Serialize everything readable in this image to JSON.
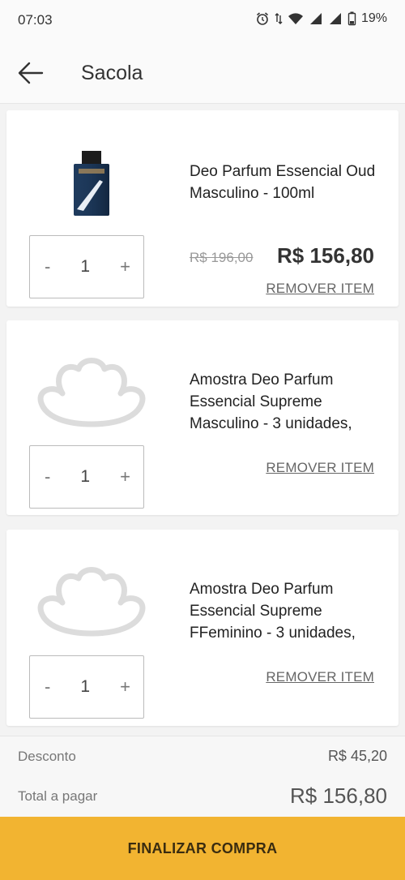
{
  "status_bar": {
    "time": "07:03",
    "battery": "19%"
  },
  "header": {
    "title": "Sacola"
  },
  "items": [
    {
      "name": "Deo Parfum Essencial Oud Masculino - 100ml",
      "quantity": "1",
      "old_price": "R$ 196,00",
      "price": "R$ 156,80",
      "remove_label": "REMOVER ITEM",
      "image": "perfume-bottle"
    },
    {
      "name": "Amostra Deo Parfum Essencial Supreme Masculino - 3 unidades,",
      "quantity": "1",
      "remove_label": "REMOVER ITEM",
      "image": "natura-logo-placeholder"
    },
    {
      "name": "Amostra Deo Parfum Essencial Supreme FFeminino - 3 unidades,",
      "quantity": "1",
      "remove_label": "REMOVER ITEM",
      "image": "natura-logo-placeholder"
    }
  ],
  "qty_controls": {
    "minus": "-",
    "plus": "+"
  },
  "summary": {
    "discount_label": "Desconto",
    "discount_value": "R$ 45,20",
    "total_label": "Total a pagar",
    "total_value": "R$ 156,80"
  },
  "checkout": {
    "label": "FINALIZAR COMPRA"
  },
  "colors": {
    "accent": "#f2b431"
  }
}
